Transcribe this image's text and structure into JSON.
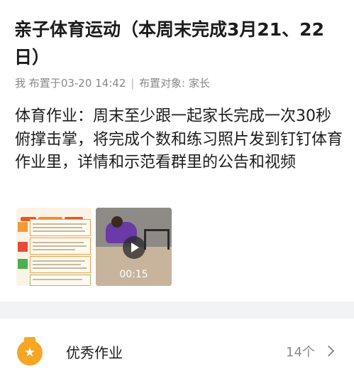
{
  "post": {
    "title": "亲子体育运动（本周末完成3月21、22日）",
    "author": "我",
    "assigned_label": "布置于",
    "assigned_time": "03-20 14:42",
    "separator": "|",
    "target_label": "布置对象:",
    "target_value": "家长",
    "body": "体育作业：周末至少跟一起家长完成一次30秒俯撑击掌，将完成个数和练习照片发到钉钉体育作业里，详情和示范看群里的公告和视频"
  },
  "attachments": {
    "video_duration": "00:15"
  },
  "excellent": {
    "label": "优秀作业",
    "count": "14个",
    "icon": "medal-star-icon",
    "icon_color": "#f5a623"
  },
  "colors": {
    "background": "#f2f3f5",
    "card": "#ffffff",
    "meta_text": "#888888"
  }
}
